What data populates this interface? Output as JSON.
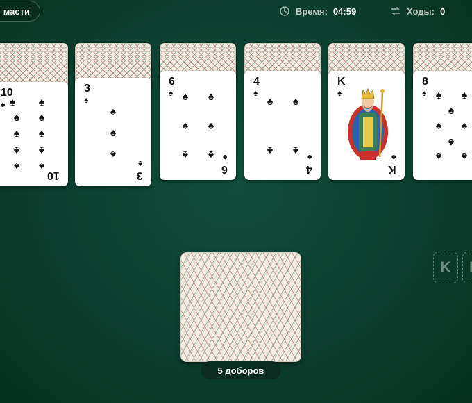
{
  "header": {
    "suits_label": "масти",
    "time_label": "Время:",
    "time_value": "04:59",
    "moves_label": "Ходы:",
    "moves_value": "0"
  },
  "tableau": [
    {
      "rank": "10",
      "suit": "♠"
    },
    {
      "rank": "3",
      "suit": "♠"
    },
    {
      "rank": "6",
      "suit": "♠"
    },
    {
      "rank": "4",
      "suit": "♠"
    },
    {
      "rank": "K",
      "suit": "♠"
    },
    {
      "rank": "8",
      "suit": "♠"
    }
  ],
  "stock": {
    "draws_label": "5 доборов"
  },
  "foundations": [
    {
      "label": "K"
    },
    {
      "label": "K"
    }
  ],
  "colors": {
    "table": "#0b3f2f",
    "card_back": "#f4ede4",
    "badge": "#0a2e22"
  }
}
